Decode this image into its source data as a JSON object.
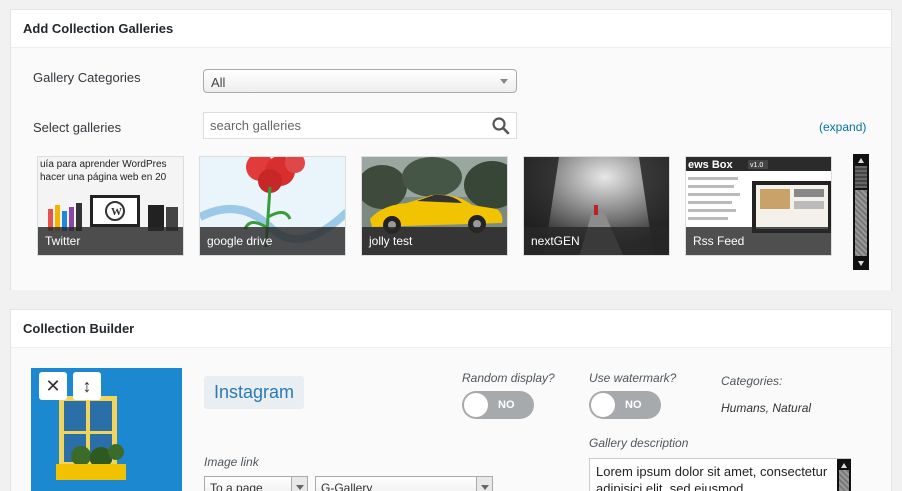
{
  "add_panel": {
    "title": "Add Collection Galleries",
    "category_label": "Gallery Categories",
    "category_value": "All",
    "select_label": "Select galleries",
    "search_placeholder": "search galleries",
    "expand_label": "(expand)",
    "galleries": [
      {
        "caption": "Twitter",
        "thumb_text_1": "uía para aprender WordPres",
        "thumb_text_2": "hacer una página web en 20"
      },
      {
        "caption": "google drive"
      },
      {
        "caption": "jolly test"
      },
      {
        "caption": "nextGEN"
      },
      {
        "caption": "Rss Feed",
        "thumb_text_1": "ews Box",
        "thumb_badge": "v1.0"
      }
    ]
  },
  "builder_panel": {
    "title": "Collection Builder",
    "item": {
      "close_icon": "✕",
      "move_icon": "↕",
      "name": "Instagram",
      "random_label": "Random display?",
      "random_state": "NO",
      "watermark_label": "Use watermark?",
      "watermark_state": "NO",
      "categories_label": "Categories:",
      "categories_value": "Humans, Natural",
      "description_label": "Gallery description",
      "description_value": "Lorem ipsum dolor sit amet, consectetur adipisici elit, sed eiusmod",
      "image_link_label": "Image link",
      "link_type": "To a page",
      "link_target": "G-Gallery"
    }
  },
  "colors": {
    "accent": "#0073aa",
    "tag_text": "#2a7ab0",
    "toggle_off": "#a7aaad"
  }
}
